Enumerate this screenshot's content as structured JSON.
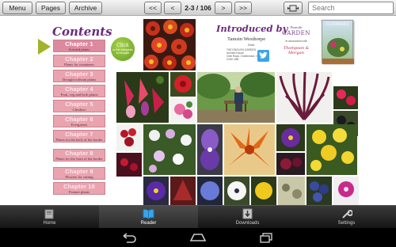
{
  "toolbar": {
    "menu_label": "Menu",
    "pages_label": "Pages",
    "archive_label": "Archive",
    "first_label": "<<",
    "prev_label": "<",
    "page_indicator": "2-3 / 106",
    "next_label": ">",
    "last_label": ">>",
    "fit_icon": "fit-width-icon",
    "search_placeholder": "Search"
  },
  "contents": {
    "title": "Contents",
    "chapters": [
      {
        "title": "Chapter 1",
        "subtitle": "Scented plants"
      },
      {
        "title": "Chapter 2",
        "subtitle": "Plants for containers"
      },
      {
        "title": "Chapter 3",
        "subtitle": "Drought tolerant plants"
      },
      {
        "title": "Chapter 4",
        "subtitle": "Fruit, veg and herb plants"
      },
      {
        "title": "Chapter 5",
        "subtitle": "Climbers"
      },
      {
        "title": "Chapter 6",
        "subtitle": "Evergreens"
      },
      {
        "title": "Chapter 7",
        "subtitle": "Plants for the back of the border"
      },
      {
        "title": "Chapter 8",
        "subtitle": "Plants for the front of the border"
      },
      {
        "title": "Chapter 9",
        "subtitle": "Flowers for cutting"
      },
      {
        "title": "Chapter 10",
        "subtitle": "Feature plants"
      }
    ],
    "badge_title": "Click",
    "badge_text": "on the categories to navigate"
  },
  "intro": {
    "heading": "Introduced by",
    "name": "Tamsin Westhorpe",
    "editor": "Editor",
    "publisher": "THE ENGLISH GARDEN",
    "address1": "Archant House",
    "address2": "Oriel Road, Cheltenham, Glos",
    "address3": "GL50 1BB"
  },
  "partner": {
    "from": "From the",
    "name": "GARDEN",
    "assoc": "in association with",
    "brand": "Thompson & Morgan"
  },
  "magazine": {
    "title": "CLIMBERS"
  },
  "bottom_nav": {
    "tabs": [
      {
        "label": "Home",
        "icon": "home-icon"
      },
      {
        "label": "Reader",
        "icon": "book-icon"
      },
      {
        "label": "Downloads",
        "icon": "download-icon"
      },
      {
        "label": "Settings",
        "icon": "wrench-icon"
      }
    ],
    "active": "Reader"
  },
  "system_bar": {
    "icons": [
      "back-icon",
      "home-icon",
      "recent-apps-icon"
    ]
  },
  "colors": {
    "accent_purple": "#6b2a7a",
    "chapter_pink": "#e9a4b0",
    "arrow_green": "#a3b22a",
    "badge_green": "#6fae2a"
  }
}
